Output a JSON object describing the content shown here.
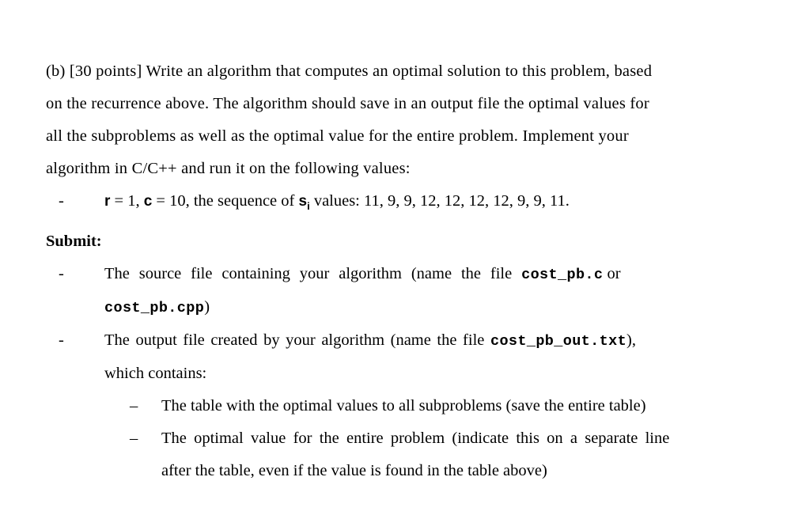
{
  "document": {
    "question": {
      "label": "(b)",
      "points": "[30 points]",
      "line1": "(b) [30 points] Write an algorithm that computes an optimal solution to this problem, based",
      "line2": "on the recurrence above. The algorithm should save in an output file the optimal values for",
      "line3": "all the subproblems as well as the optimal value for the entire problem.  Implement your",
      "line4": "algorithm in C/C++ and run it on the following values:"
    },
    "values_bullet": {
      "marker": "-",
      "text_before_r": "",
      "var_r": "r",
      "eq_r": " = 1, ",
      "var_c": "c",
      "eq_c": " = 10, the sequence of ",
      "var_s": "s",
      "var_s_subscript": "i",
      "text_after": " values: 11, 9, 9, 12, 12, 12, 12, 9, 9, 11.",
      "r_value": "1",
      "c_value": "10",
      "sequence": [
        11,
        9,
        9,
        12,
        12,
        12,
        12,
        9,
        9,
        11
      ]
    },
    "submit_heading": "Submit:",
    "submit_items": [
      {
        "marker": "-",
        "line1_pre": "The source file containing your algorithm (name the file ",
        "code1": "cost_pb.c",
        "line1_post": " or",
        "line2_code": "cost_pb.cpp",
        "line2_post": ")"
      },
      {
        "marker": "-",
        "line1_pre": "The output file created by your algorithm (name the file ",
        "code1": "cost_pb_out.txt",
        "line1_post": "),",
        "line2": "which contains:"
      }
    ],
    "sub_items": [
      {
        "marker": "–",
        "text": "The table with the optimal values to all subproblems (save the entire table)"
      },
      {
        "marker": "–",
        "line1": "The optimal value for the entire problem (indicate this on a separate line",
        "line2": "after the table, even if the value is found in the table above)"
      }
    ]
  }
}
